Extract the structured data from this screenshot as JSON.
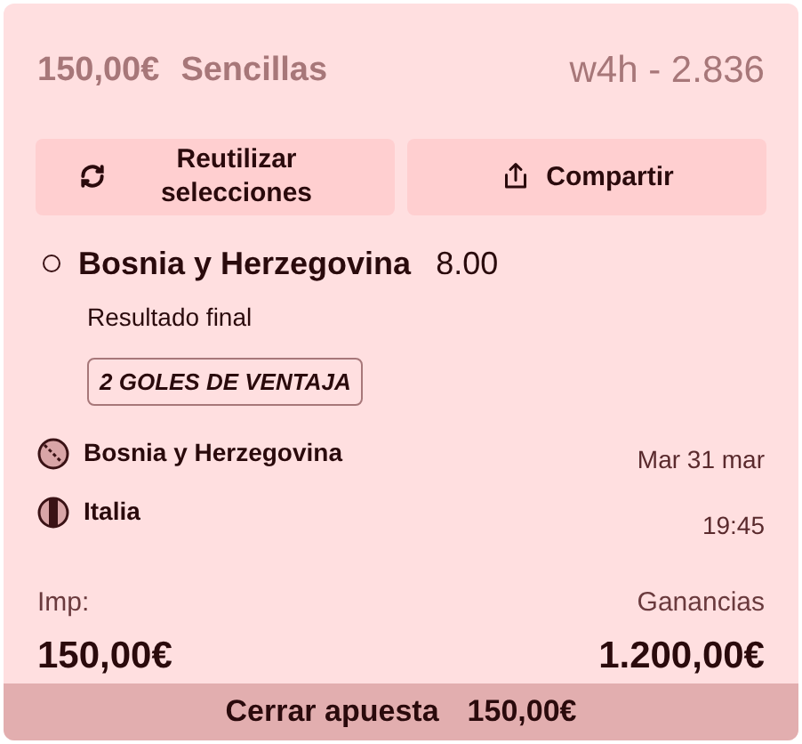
{
  "header": {
    "stake": "150,00€",
    "bet_type": "Sencillas",
    "code": "w4h - 2.836"
  },
  "actions": [
    {
      "kind": "reuse",
      "label": "Reutilizar selecciones"
    },
    {
      "kind": "share",
      "label": "Compartir"
    }
  ],
  "selection": {
    "selected": false,
    "name": "Bosnia y Herzegovina",
    "odds": "8.00",
    "market": "Resultado final",
    "tag": "2 GOLES DE VENTAJA"
  },
  "event": {
    "teams": [
      {
        "name": "Bosnia y Herzegovina",
        "kind": "diagonal"
      },
      {
        "name": "Italia",
        "kind": "vertical"
      }
    ],
    "date": "Mar 31 mar",
    "time": "19:45"
  },
  "totals": {
    "stake_label": "Imp:",
    "stake": "150,00€",
    "winnings_label": "Ganancias",
    "winnings": "1.200,00€"
  },
  "cashout": {
    "label": "Cerrar apuesta",
    "amount": "150,00€"
  }
}
